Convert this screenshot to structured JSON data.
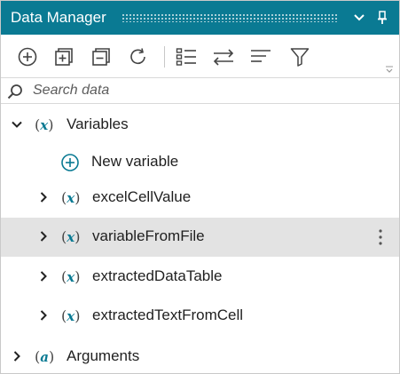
{
  "titlebar": {
    "title": "Data Manager",
    "buttons": [
      "chevron-down-icon",
      "pin-icon"
    ]
  },
  "toolbar": {
    "tools": [
      "add-icon",
      "add-group-icon",
      "remove-group-icon",
      "refresh-icon",
      "list-view-icon",
      "swap-icon",
      "sort-icon",
      "filter-icon"
    ]
  },
  "search": {
    "placeholder": "Search data",
    "value": ""
  },
  "tree": {
    "variables": {
      "label": "Variables",
      "new_item": "New variable",
      "items": [
        {
          "label": "excelCellValue",
          "selected": false
        },
        {
          "label": "variableFromFile",
          "selected": true
        },
        {
          "label": "extractedDataTable",
          "selected": false
        },
        {
          "label": "extractedTextFromCell",
          "selected": false
        }
      ]
    },
    "arguments": {
      "label": "Arguments"
    }
  },
  "colors": {
    "titlebar": "#0a7a93",
    "accent": "#0a7a93",
    "selected_row": "#e3e3e3",
    "icon_gray": "#444444"
  }
}
